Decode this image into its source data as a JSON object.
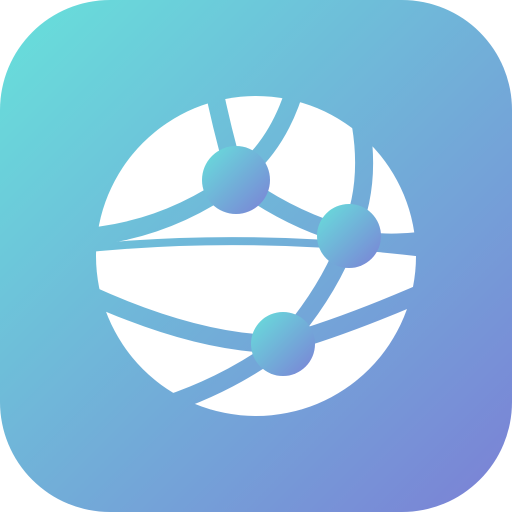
{
  "app_icon": {
    "icon_name": "globe-network-icon",
    "background_gradient": {
      "start_color": "#67E1DB",
      "end_color": "#7B80D6"
    },
    "glyph_color": "#FFFFFF"
  }
}
